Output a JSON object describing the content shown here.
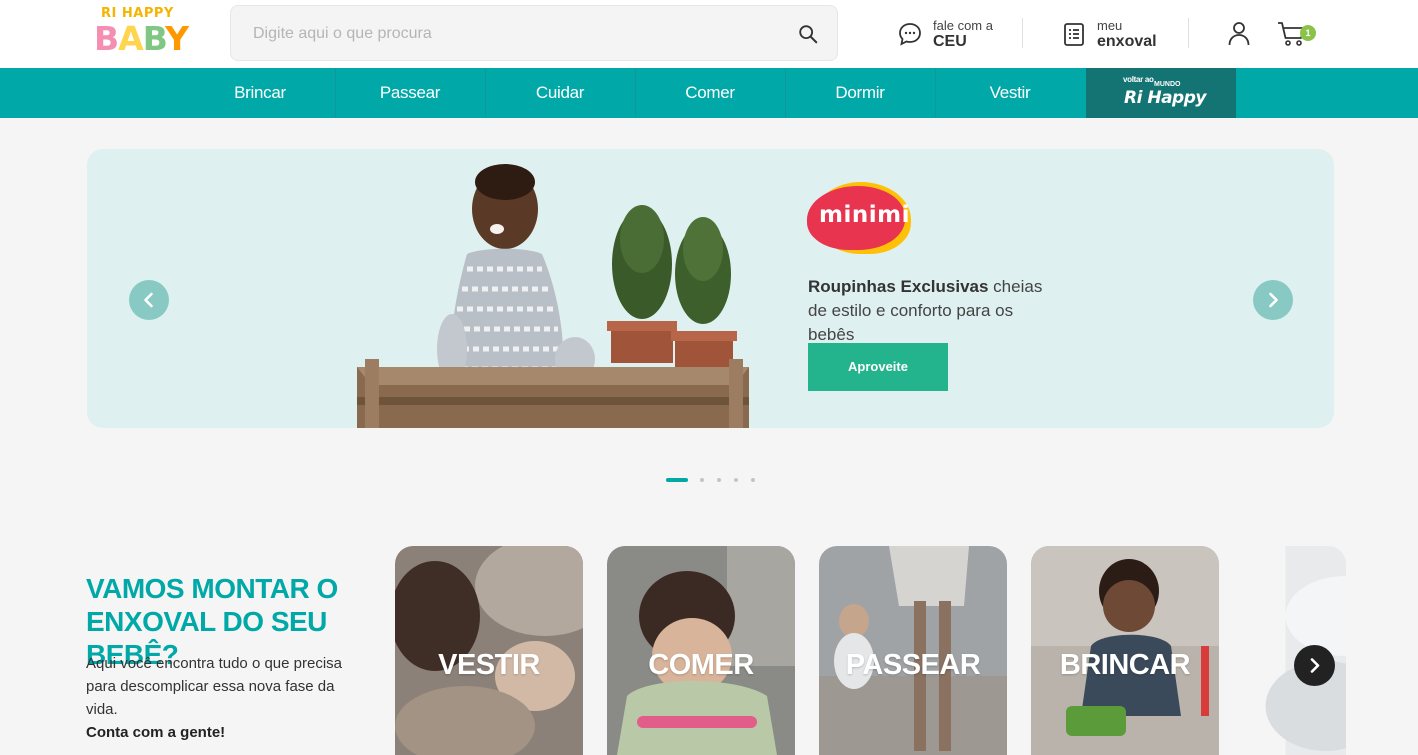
{
  "brand": {
    "top": "RI HAPPY",
    "bottom": [
      "B",
      "A",
      "B",
      "Y"
    ]
  },
  "search": {
    "placeholder": "Digite aqui o que procura"
  },
  "header": {
    "ceu": {
      "small": "fale com a",
      "big": "CEU"
    },
    "enxoval": {
      "small": "meu",
      "big": "enxoval"
    },
    "cart_count": "1"
  },
  "nav": {
    "items": [
      "Brincar",
      "Passear",
      "Cuidar",
      "Comer",
      "Dormir",
      "Vestir"
    ],
    "back": {
      "line1": "voltar ao",
      "line2": "MUNDO",
      "line3": "Ri Happy"
    }
  },
  "banner": {
    "logo_text": "minimi",
    "text_bold": "Roupinhas Exclusivas",
    "text_rest": " cheias de estilo e conforto para os bebês",
    "button": "Aproveite",
    "active_slide": 1,
    "slide_count": 5
  },
  "enxoval": {
    "title": "VAMOS MONTAR O ENXOVAL DO SEU BEBÊ?",
    "desc": "Aqui você encontra tudo o que precisa para descomplicar essa nova fase da vida.",
    "cta": "Conta com a gente!",
    "cards": [
      "VESTIR",
      "COMER",
      "PASSEAR",
      "BRINCAR"
    ]
  },
  "colors": {
    "primary": "#00a8a8",
    "nav_back": "#137473",
    "button": "#23b48d",
    "banner_bg": "#dff0f0"
  }
}
